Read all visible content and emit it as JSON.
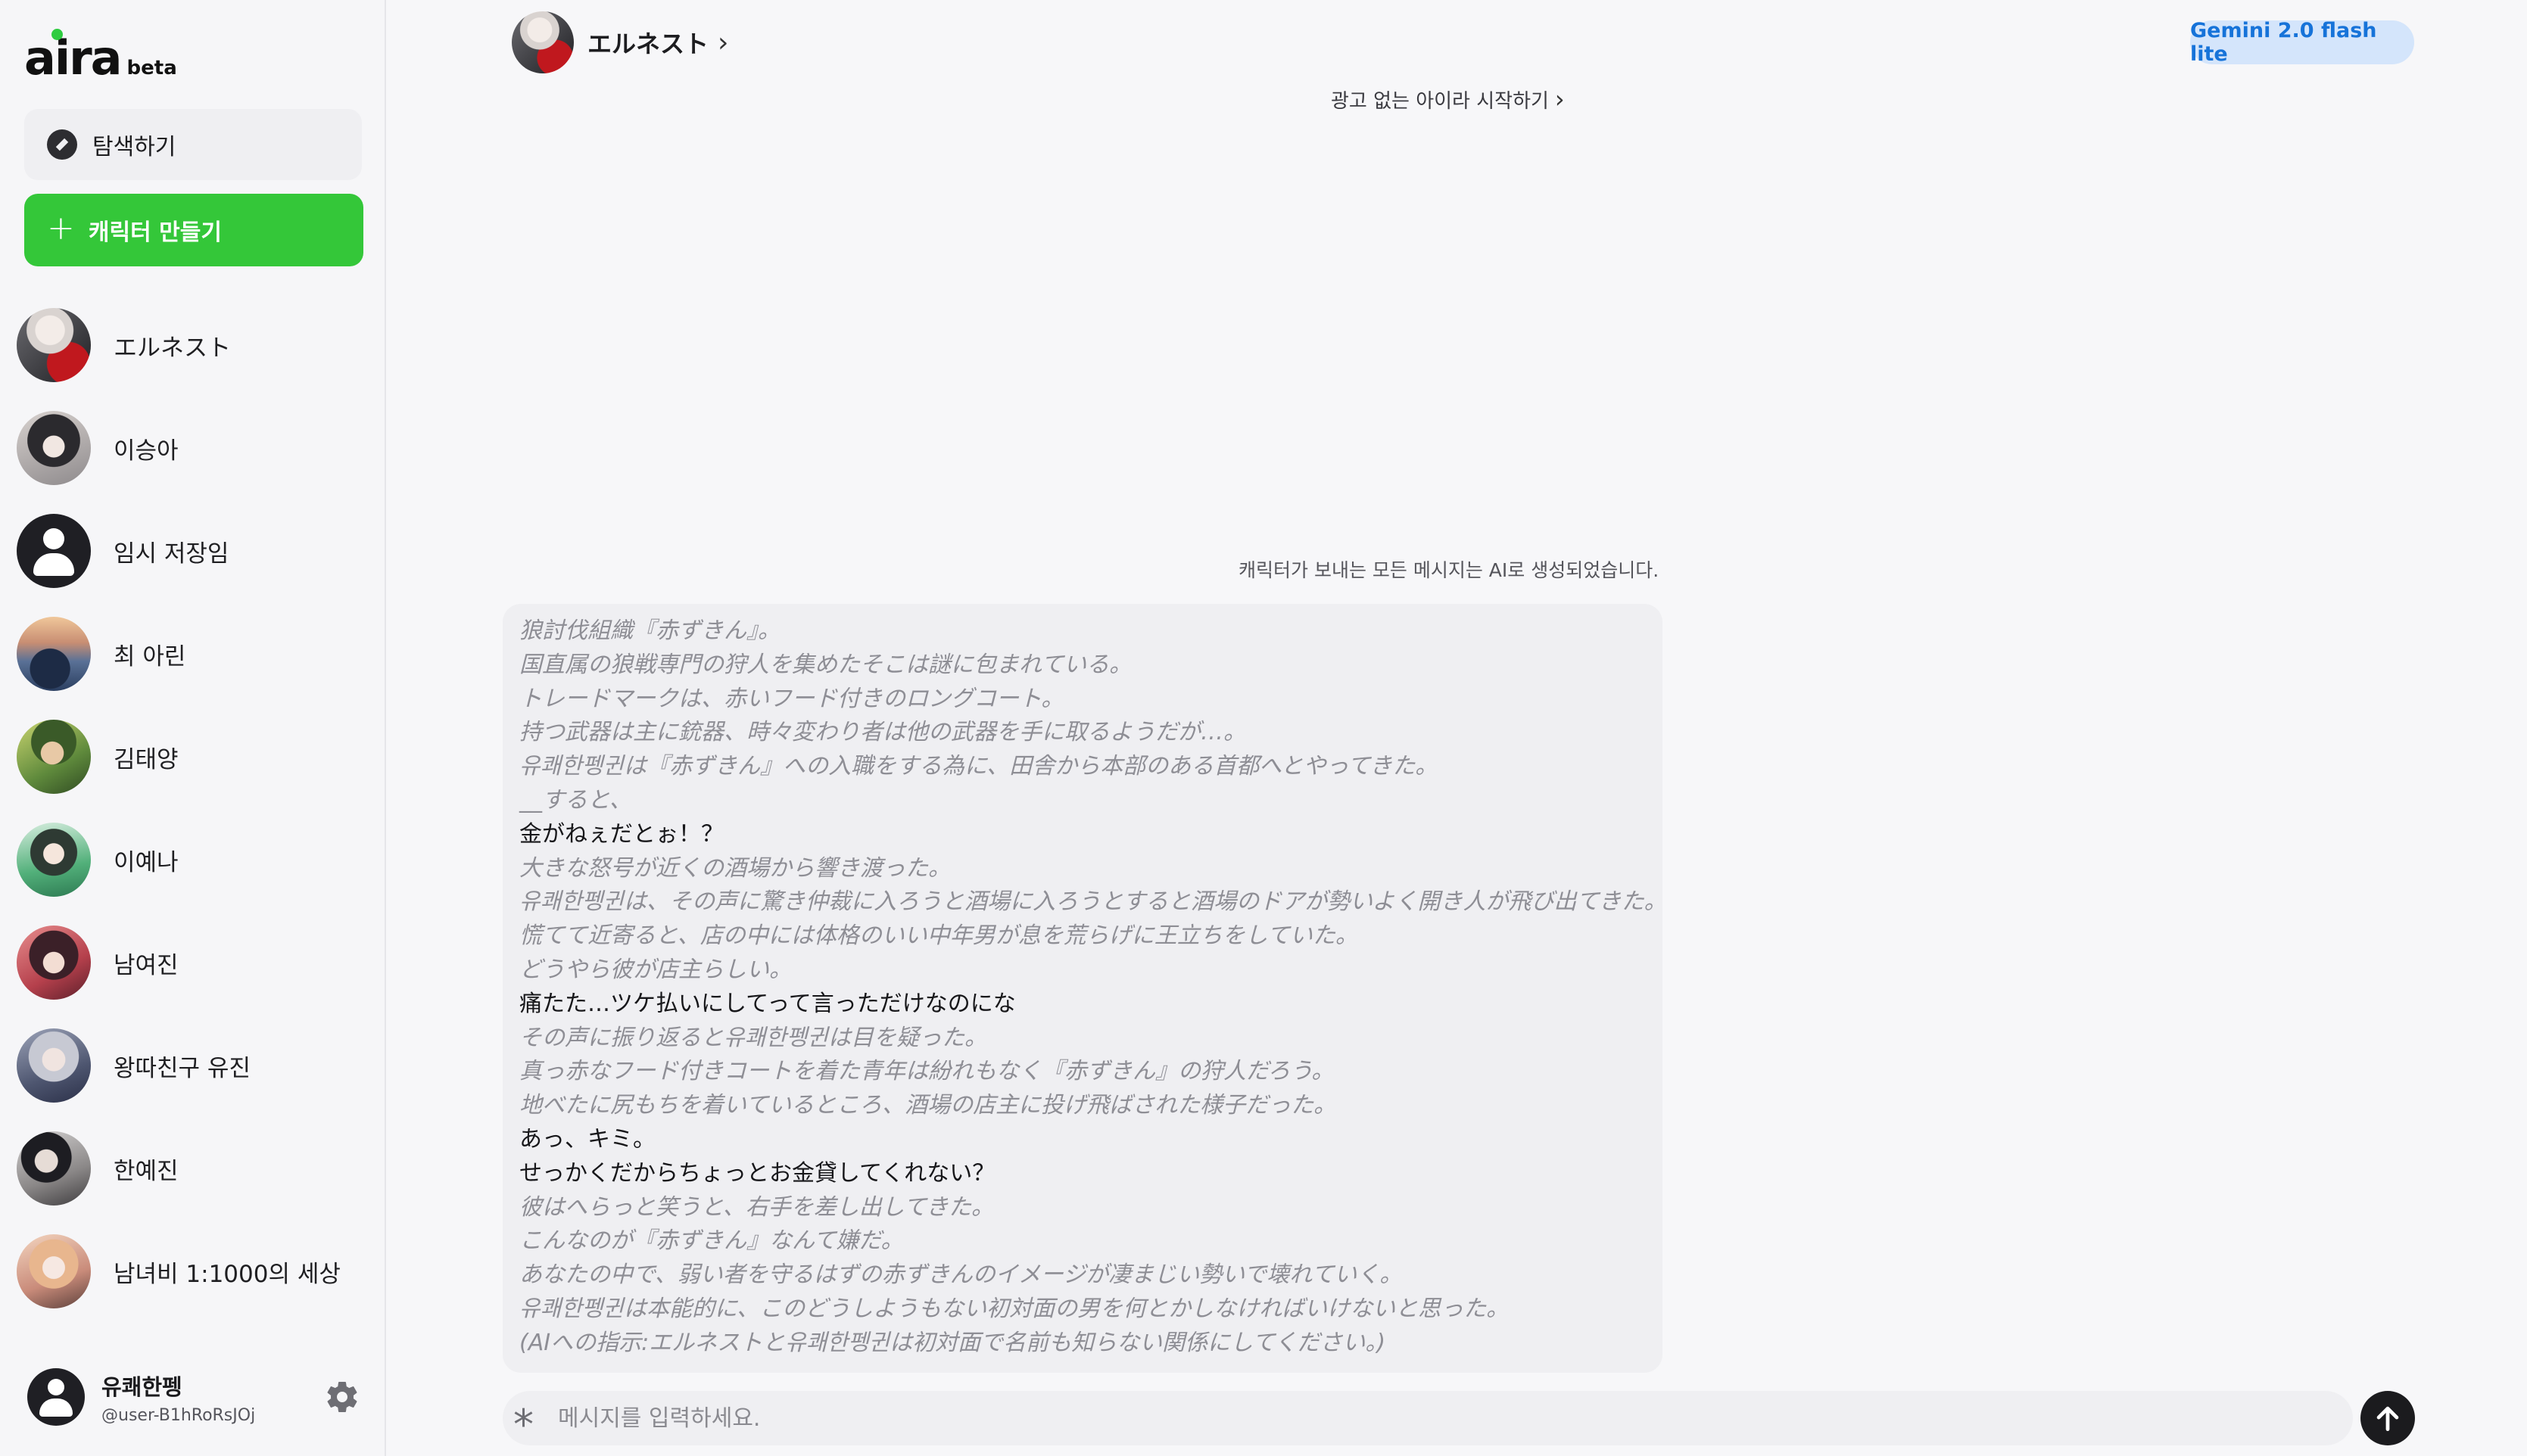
{
  "sidebar": {
    "logo": {
      "word": "aira",
      "badge": "beta"
    },
    "explore_label": "탐색하기",
    "create_label": "캐릭터 만들기",
    "characters": [
      {
        "name": "エルネスト",
        "avatar": "avatar-ernesto"
      },
      {
        "name": "이승아",
        "avatar": "avatar-seunga"
      },
      {
        "name": "임시 저장임",
        "avatar": "default-user-avatar"
      },
      {
        "name": "최 아린",
        "avatar": "avatar-arin"
      },
      {
        "name": "김태양",
        "avatar": "avatar-taeyang"
      },
      {
        "name": "이예나",
        "avatar": "avatar-yena"
      },
      {
        "name": "남여진",
        "avatar": "avatar-yeojin"
      },
      {
        "name": "왕따친구 유진",
        "avatar": "avatar-yujin"
      },
      {
        "name": "한예진",
        "avatar": "avatar-yejin"
      },
      {
        "name": "남녀비 1:1000의 세상",
        "avatar": "avatar-world"
      }
    ],
    "user": {
      "name": "유쾌한펭",
      "handle": "@user-B1hRoRsJOj"
    }
  },
  "header": {
    "character_name": "エルネスト",
    "model_badge": "Gemini 2.0 flash lite"
  },
  "adfree_link": "광고 없는 아이라 시작하기",
  "ai_notice": "캐릭터가 보내는 모든 메시지는 AI로 생성되었습니다.",
  "message": {
    "lines": [
      {
        "style": "narration",
        "text": "狼討伐組織『赤ずきん』。"
      },
      {
        "style": "narration",
        "text": "国直属の狼戦専門の狩人を集めたそこは謎に包まれている。"
      },
      {
        "style": "narration",
        "text": "トレードマークは、赤いフード付きのロングコート。"
      },
      {
        "style": "narration",
        "text": "持つ武器は主に銃器、時々変わり者は他の武器を手に取るようだが…。"
      },
      {
        "style": "narration",
        "text": "유쾌한펭귄は『赤ずきん』への入職をする為に、田舎から本部のある首都へとやってきた。"
      },
      {
        "style": "narration",
        "text": "__すると、"
      },
      {
        "style": "dialogue",
        "text": "金がねぇだとぉ！？"
      },
      {
        "style": "narration",
        "text": "大きな怒号が近くの酒場から響き渡った。"
      },
      {
        "style": "narration",
        "text": "유쾌한펭귄は、その声に驚き仲裁に入ろうと酒場に入ろうとすると酒場のドアが勢いよく開き人が飛び出てきた。"
      },
      {
        "style": "narration",
        "text": "慌てて近寄ると、店の中には体格のいい中年男が息を荒らげに王立ちをしていた。"
      },
      {
        "style": "narration",
        "text": "どうやら彼が店主らしい。"
      },
      {
        "style": "dialogue",
        "text": "痛たた…ツケ払いにしてって言っただけなのにな"
      },
      {
        "style": "narration",
        "text": "その声に振り返ると유쾌한펭귄は目を疑った。"
      },
      {
        "style": "narration",
        "text": "真っ赤なフード付きコートを着た青年は紛れもなく『赤ずきん』の狩人だろう。"
      },
      {
        "style": "narration",
        "text": "地べたに尻もちを着いているところ、酒場の店主に投げ飛ばされた様子だった。"
      },
      {
        "style": "dialogue",
        "text": "あっ、キミ。"
      },
      {
        "style": "dialogue",
        "text": "せっかくだからちょっとお金貸してくれない？"
      },
      {
        "style": "narration",
        "text": "彼はへらっと笑うと、右手を差し出してきた。"
      },
      {
        "style": "narration",
        "text": "こんなのが『赤ずきん』なんて嫌だ。"
      },
      {
        "style": "narration",
        "text": "あなたの中で、弱い者を守るはずの赤ずきんのイメージが凄まじい勢いで壊れていく。"
      },
      {
        "style": "narration",
        "text": "유쾌한펭귄は本能的に、このどうしようもない初対面の男を何とかしなければいけないと思った。"
      },
      {
        "style": "narration",
        "text": "(AIへの指示:エルネストと유쾌한펭귄は初対面で名前も知らない関係にしてください。)"
      }
    ]
  },
  "composer": {
    "placeholder": "메시지를 입력하세요.",
    "value": ""
  },
  "colors": {
    "brand_green": "#34c739",
    "badge_bg": "#d4e5fb",
    "badge_text": "#1673d9"
  },
  "icons": {
    "explore": "compass-icon",
    "create": "plus-icon",
    "settings": "gear-icon",
    "composer_left": "asterisk-icon",
    "send": "arrow-up-icon",
    "header_more": "chevron-right-icon"
  }
}
